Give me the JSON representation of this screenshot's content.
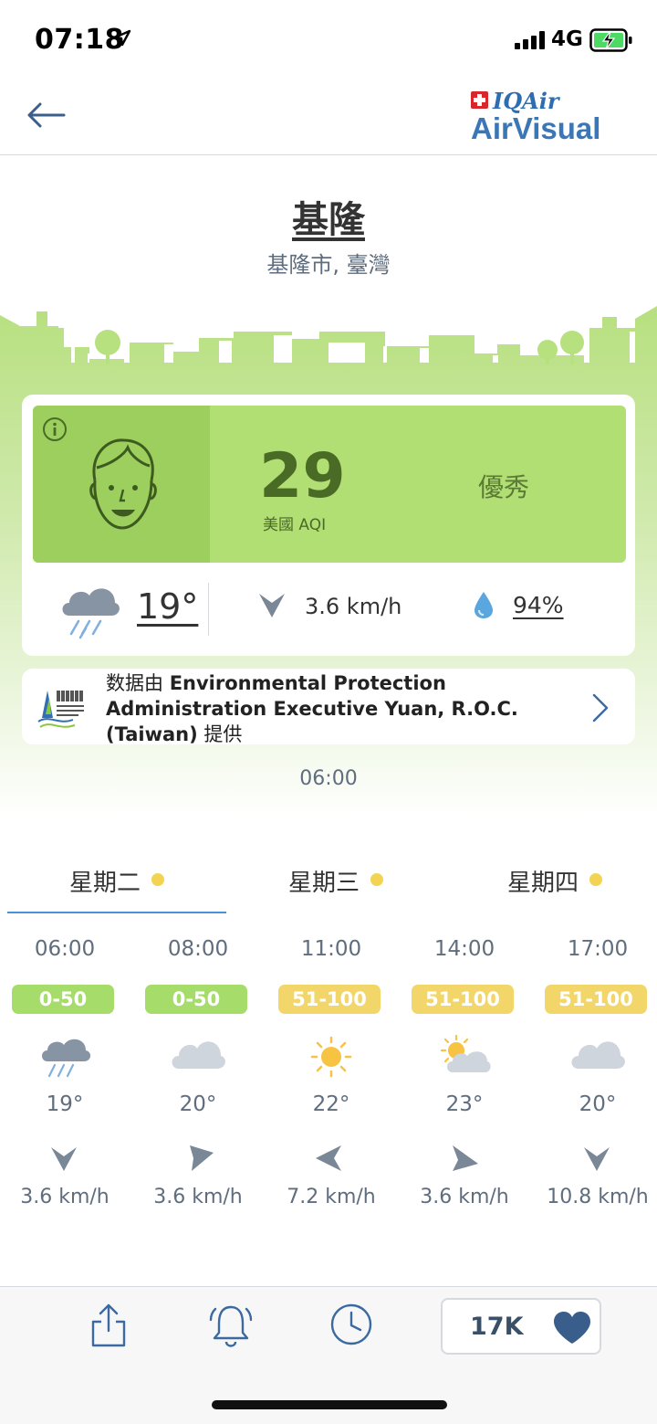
{
  "status_bar": {
    "time": "07:18",
    "network": "4G"
  },
  "header": {
    "logo_iq": "IQAir",
    "logo_main": "AirVisual"
  },
  "location": {
    "city": "基隆",
    "region": "基隆市, 臺灣"
  },
  "aqi": {
    "value": "29",
    "unit": "美國 AQI",
    "status": "優秀",
    "color": "#b2df73"
  },
  "current_weather": {
    "temperature": "19°",
    "wind": "3.6 km/h",
    "humidity": "94%",
    "icon": "rain-cloud-icon"
  },
  "source": {
    "prefix": "数据由 ",
    "name": "Environmental Protection Administration Executive Yuan, R.O.C. (Taiwan)",
    "suffix": " 提供"
  },
  "update_time": "06:00",
  "days": [
    {
      "label": "星期二"
    },
    {
      "label": "星期三"
    },
    {
      "label": "星期四"
    }
  ],
  "hourly": [
    {
      "time": "06:00",
      "range": "0-50",
      "level": "green",
      "icon": "rain-cloud-icon",
      "temp": "19°",
      "wind": "3.6 km/h",
      "wind_dir": "south"
    },
    {
      "time": "08:00",
      "range": "0-50",
      "level": "green",
      "icon": "cloud-icon",
      "temp": "20°",
      "wind": "3.6 km/h",
      "wind_dir": "south-east"
    },
    {
      "time": "11:00",
      "range": "51-100",
      "level": "yellow",
      "icon": "sun-icon",
      "temp": "22°",
      "wind": "7.2 km/h",
      "wind_dir": "west"
    },
    {
      "time": "14:00",
      "range": "51-100",
      "level": "yellow",
      "icon": "partly-cloudy-icon",
      "temp": "23°",
      "wind": "3.6 km/h",
      "wind_dir": "east"
    },
    {
      "time": "17:00",
      "range": "51-100",
      "level": "yellow",
      "icon": "cloud-icon",
      "temp": "20°",
      "wind": "10.8 km/h",
      "wind_dir": "south"
    }
  ],
  "bottom_bar": {
    "like_count": "17K"
  },
  "colors": {
    "accent": "#3b77b6",
    "good": "#a6dc6a",
    "moderate": "#f2d66a",
    "tab_underline": "#4a90d9"
  }
}
